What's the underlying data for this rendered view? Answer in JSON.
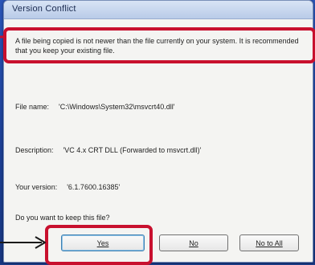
{
  "dialog": {
    "title": "Version Conflict",
    "message": "A file being copied is not newer than the file currently on your system. It is recommended that you keep your existing file.",
    "file_name_label": "File name:",
    "file_name_value": "'C:\\Windows\\System32\\msvcrt40.dll'",
    "description_label": "Description:",
    "description_value": "'VC 4.x CRT DLL (Forwarded to msvcrt.dll)'",
    "version_label": "Your version:",
    "version_value": "'6.1.7600.16385'",
    "question": "Do you want to keep this file?"
  },
  "buttons": {
    "yes": "Yes",
    "no": "No",
    "no_to_all": "No to All"
  },
  "annotations": {
    "highlight_color": "#c8102e",
    "arrow_color": "#1a1a1a"
  }
}
